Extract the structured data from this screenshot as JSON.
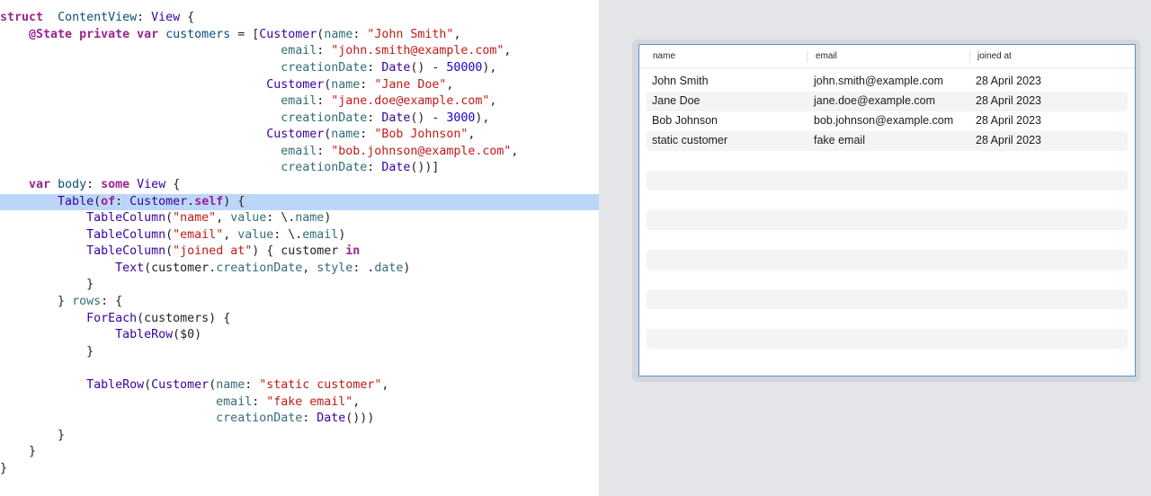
{
  "editor": {
    "lines": [
      [
        [
          "k",
          "struct"
        ],
        [
          "",
          "  "
        ],
        [
          "t",
          "ContentView"
        ],
        [
          "",
          ": "
        ],
        [
          "ut",
          "View"
        ],
        [
          "",
          " {"
        ]
      ],
      [
        [
          "",
          "    "
        ],
        [
          "k",
          "@State private var"
        ],
        [
          "",
          " "
        ],
        [
          "t",
          "customers"
        ],
        [
          "",
          " = ["
        ],
        [
          "ut",
          "Customer"
        ],
        [
          "",
          "("
        ],
        [
          "p",
          "name"
        ],
        [
          "",
          ": "
        ],
        [
          "s",
          "\"John Smith\""
        ],
        [
          "",
          ","
        ]
      ],
      [
        [
          "",
          "                                       "
        ],
        [
          "p",
          "email"
        ],
        [
          "",
          ": "
        ],
        [
          "s",
          "\"john.smith@example.com\""
        ],
        [
          "",
          ","
        ]
      ],
      [
        [
          "",
          "                                       "
        ],
        [
          "p",
          "creationDate"
        ],
        [
          "",
          ": "
        ],
        [
          "ut",
          "Date"
        ],
        [
          "",
          "() - "
        ],
        [
          "n",
          "50000"
        ],
        [
          "",
          "),"
        ]
      ],
      [
        [
          "",
          "                                     "
        ],
        [
          "ut",
          "Customer"
        ],
        [
          "",
          "("
        ],
        [
          "p",
          "name"
        ],
        [
          "",
          ": "
        ],
        [
          "s",
          "\"Jane Doe\""
        ],
        [
          "",
          ","
        ]
      ],
      [
        [
          "",
          "                                       "
        ],
        [
          "p",
          "email"
        ],
        [
          "",
          ": "
        ],
        [
          "s",
          "\"jane.doe@example.com\""
        ],
        [
          "",
          ","
        ]
      ],
      [
        [
          "",
          "                                       "
        ],
        [
          "p",
          "creationDate"
        ],
        [
          "",
          ": "
        ],
        [
          "ut",
          "Date"
        ],
        [
          "",
          "() - "
        ],
        [
          "n",
          "3000"
        ],
        [
          "",
          "),"
        ]
      ],
      [
        [
          "",
          "                                     "
        ],
        [
          "ut",
          "Customer"
        ],
        [
          "",
          "("
        ],
        [
          "p",
          "name"
        ],
        [
          "",
          ": "
        ],
        [
          "s",
          "\"Bob Johnson\""
        ],
        [
          "",
          ","
        ]
      ],
      [
        [
          "",
          "                                       "
        ],
        [
          "p",
          "email"
        ],
        [
          "",
          ": "
        ],
        [
          "s",
          "\"bob.johnson@example.com\""
        ],
        [
          "",
          ","
        ]
      ],
      [
        [
          "",
          "                                       "
        ],
        [
          "p",
          "creationDate"
        ],
        [
          "",
          ": "
        ],
        [
          "ut",
          "Date"
        ],
        [
          "",
          "())]"
        ]
      ],
      [
        [
          "",
          "    "
        ],
        [
          "k",
          "var"
        ],
        [
          "",
          " "
        ],
        [
          "t",
          "body"
        ],
        [
          "",
          ": "
        ],
        [
          "k",
          "some"
        ],
        [
          "",
          " "
        ],
        [
          "ut",
          "View"
        ],
        [
          "",
          " {"
        ]
      ],
      [
        [
          "",
          "        "
        ],
        [
          "ut",
          "Table"
        ],
        [
          "",
          "("
        ],
        [
          "k",
          "of"
        ],
        [
          "",
          ": "
        ],
        [
          "ut",
          "Customer"
        ],
        [
          "",
          "."
        ],
        [
          "k",
          "self"
        ],
        [
          "",
          ") {"
        ]
      ],
      [
        [
          "",
          "            "
        ],
        [
          "ut",
          "TableColumn"
        ],
        [
          "",
          "("
        ],
        [
          "s",
          "\"name\""
        ],
        [
          "",
          ", "
        ],
        [
          "p",
          "value"
        ],
        [
          "",
          ": \\."
        ],
        [
          "p",
          "name"
        ],
        [
          "",
          ")"
        ]
      ],
      [
        [
          "",
          "            "
        ],
        [
          "ut",
          "TableColumn"
        ],
        [
          "",
          "("
        ],
        [
          "s",
          "\"email\""
        ],
        [
          "",
          ", "
        ],
        [
          "p",
          "value"
        ],
        [
          "",
          ": \\."
        ],
        [
          "p",
          "email"
        ],
        [
          "",
          ")"
        ]
      ],
      [
        [
          "",
          "            "
        ],
        [
          "ut",
          "TableColumn"
        ],
        [
          "",
          "("
        ],
        [
          "s",
          "\"joined at\""
        ],
        [
          "",
          ") { customer "
        ],
        [
          "k",
          "in"
        ]
      ],
      [
        [
          "",
          "                "
        ],
        [
          "ut",
          "Text"
        ],
        [
          "",
          "(customer."
        ],
        [
          "p",
          "creationDate"
        ],
        [
          "",
          ", "
        ],
        [
          "p",
          "style"
        ],
        [
          "",
          ": ."
        ],
        [
          "p",
          "date"
        ],
        [
          "",
          ")"
        ]
      ],
      [
        [
          "",
          "            }"
        ]
      ],
      [
        [
          "",
          "        } "
        ],
        [
          "p",
          "rows"
        ],
        [
          "",
          ": {"
        ]
      ],
      [
        [
          "",
          "            "
        ],
        [
          "ut",
          "ForEach"
        ],
        [
          "",
          "(customers) {"
        ]
      ],
      [
        [
          "",
          "                "
        ],
        [
          "ut",
          "TableRow"
        ],
        [
          "",
          "($0)"
        ]
      ],
      [
        [
          "",
          "            }"
        ]
      ],
      [
        [
          "",
          ""
        ]
      ],
      [
        [
          "",
          "            "
        ],
        [
          "ut",
          "TableRow"
        ],
        [
          "",
          "("
        ],
        [
          "ut",
          "Customer"
        ],
        [
          "",
          "("
        ],
        [
          "p",
          "name"
        ],
        [
          "",
          ": "
        ],
        [
          "s",
          "\"static customer\""
        ],
        [
          "",
          ","
        ]
      ],
      [
        [
          "",
          "                              "
        ],
        [
          "p",
          "email"
        ],
        [
          "",
          ": "
        ],
        [
          "s",
          "\"fake email\""
        ],
        [
          "",
          ","
        ]
      ],
      [
        [
          "",
          "                              "
        ],
        [
          "p",
          "creationDate"
        ],
        [
          "",
          ": "
        ],
        [
          "ut",
          "Date"
        ],
        [
          "",
          "()))"
        ]
      ],
      [
        [
          "",
          "        }"
        ]
      ],
      [
        [
          "",
          "    }"
        ]
      ],
      [
        [
          "",
          "}"
        ]
      ]
    ]
  },
  "table": {
    "headers": {
      "name": "name",
      "email": "email",
      "joined": "joined at"
    },
    "rows": [
      {
        "name": "John Smith",
        "email": "john.smith@example.com",
        "joined": "28 April 2023"
      },
      {
        "name": "Jane Doe",
        "email": "jane.doe@example.com",
        "joined": "28 April 2023"
      },
      {
        "name": "Bob Johnson",
        "email": "bob.johnson@example.com",
        "joined": "28 April 2023"
      },
      {
        "name": "static customer",
        "email": "fake email",
        "joined": "28 April 2023"
      }
    ]
  }
}
